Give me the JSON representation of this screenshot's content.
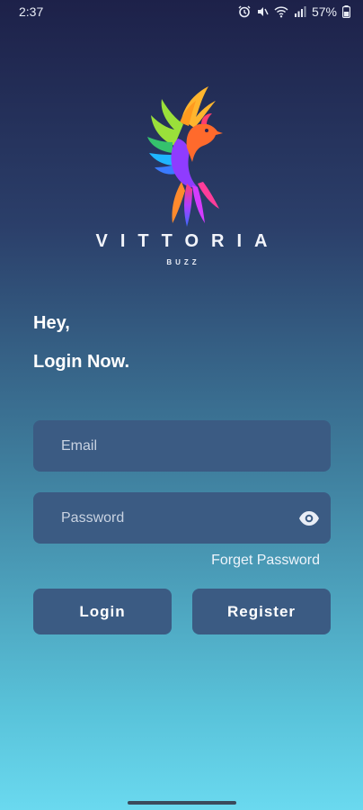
{
  "status_bar": {
    "time": "2:37",
    "battery": "57%",
    "icons": [
      "alarm-icon",
      "mute-icon",
      "wifi-icon",
      "signal-icon",
      "battery-icon"
    ]
  },
  "brand": {
    "name": "VITTORIA",
    "sub": "BUZZ",
    "logo_icon": "phoenix-logo"
  },
  "greeting": {
    "line1": "Hey,",
    "line2": "Login Now."
  },
  "form": {
    "email_placeholder": "Email",
    "password_placeholder": "Password",
    "email_value": "",
    "password_value": "",
    "password_toggle_icon": "eye-icon",
    "forget_password": "Forget Password"
  },
  "actions": {
    "login_label": "Login",
    "register_label": "Register"
  },
  "colors": {
    "background_top": "#1d2149",
    "background_bottom": "#6ad9ef",
    "field_bg": "#3b5b83",
    "button_bg": "#3b5b83"
  }
}
